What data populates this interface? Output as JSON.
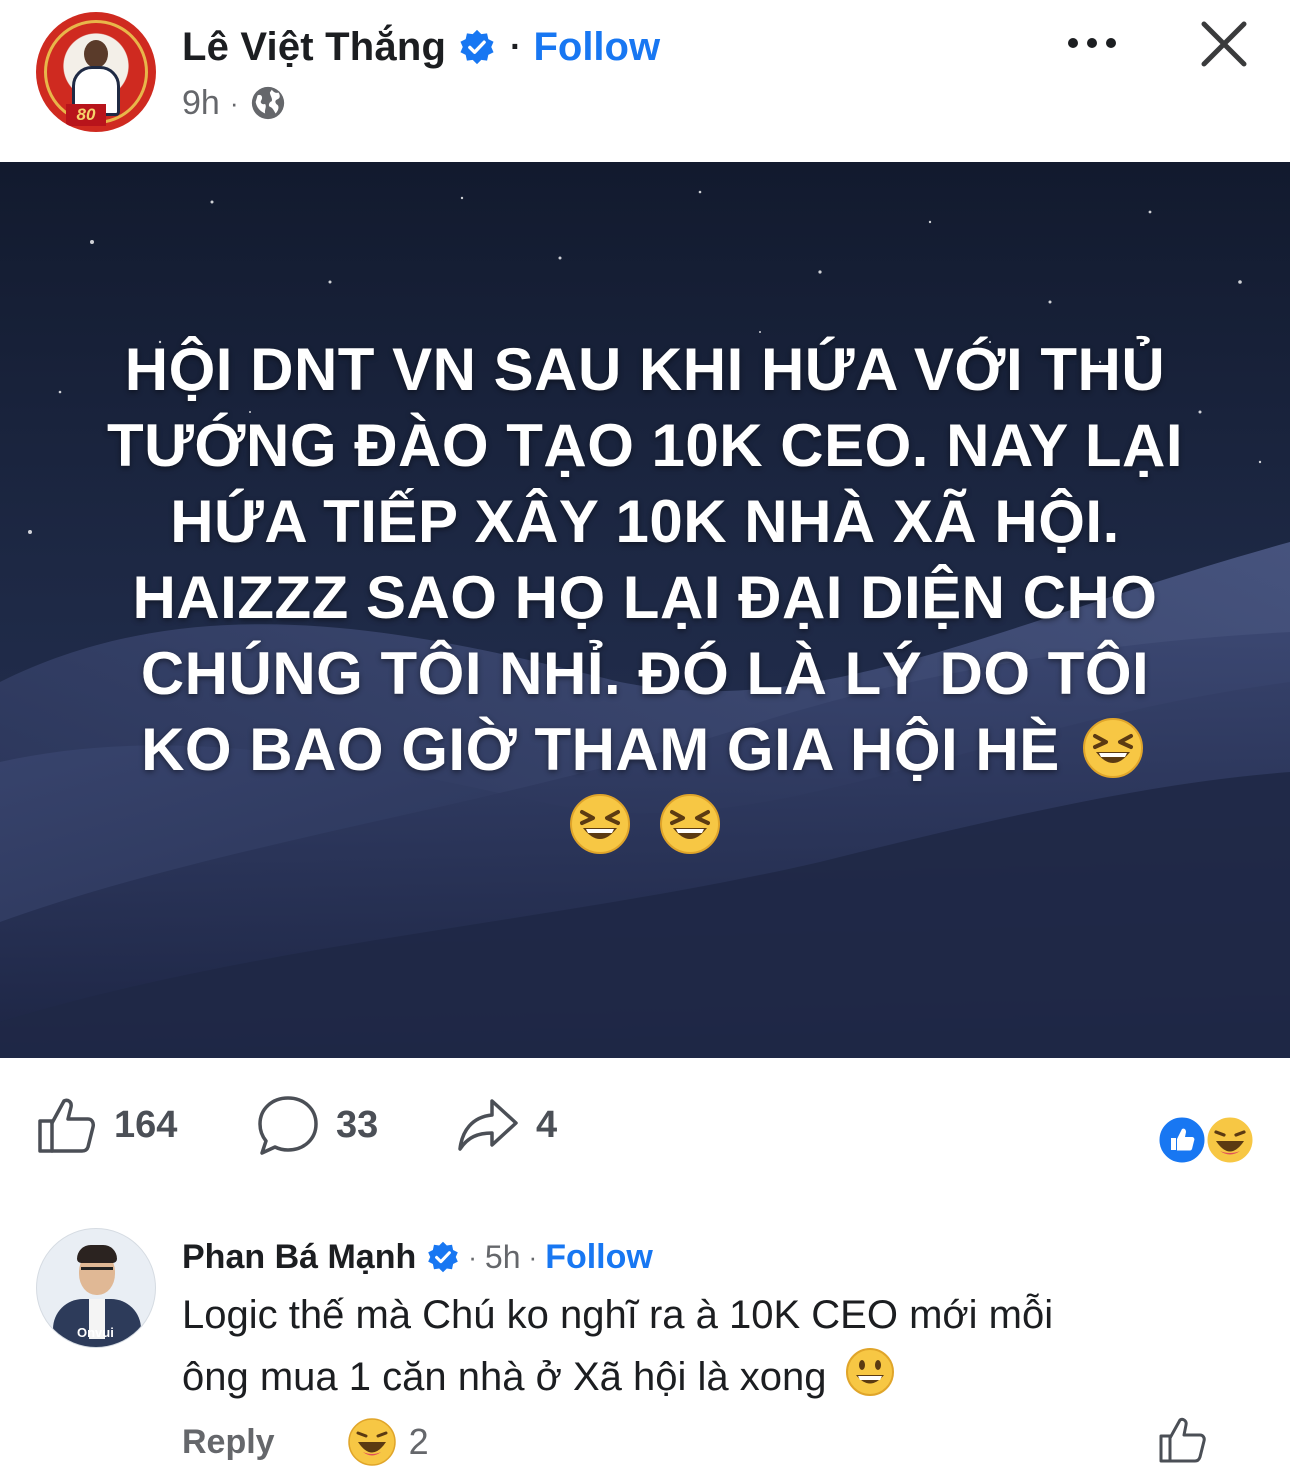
{
  "post": {
    "author": {
      "name": "Lê Việt Thắng",
      "verified": true,
      "avatar_badge_text": "80"
    },
    "follow_label": "Follow",
    "time": "9h",
    "privacy_icon": "globe-icon",
    "header_icons": [
      "more-icon",
      "close-icon"
    ],
    "image_text_lines": [
      "HỘI DNT VN SAU KHI HỨA VỚI THỦ",
      "TƯỚNG ĐÀO TẠO 10K CEO. NAY LẠI",
      "HỨA TIẾP XÂY 10K NHÀ XÃ HỘI.",
      "HAIZZZ SAO HỌ LẠI ĐẠI DIỆN CHO",
      "CHÚNG TÔI NHỈ. ĐÓ LÀ LÝ DO TÔI",
      "KO BAO GIỜ THAM GIA HỘI HÈ"
    ],
    "image_emojis": [
      "laughing-emoji",
      "laughing-emoji",
      "laughing-emoji"
    ],
    "stats": {
      "likes": "164",
      "comments": "33",
      "shares": "4"
    },
    "reaction_icons": [
      "like-reaction-icon",
      "haha-reaction-icon"
    ]
  },
  "comment": {
    "author": {
      "name": "Phan Bá Mạnh",
      "verified": true,
      "avatar_logo_text": "Onvui"
    },
    "time": "5h",
    "follow_label": "Follow",
    "text_lines": [
      "Logic thế mà Chú ko nghĩ ra à 10K CEO mới mỗi",
      "ông mua 1 căn nhà ở Xã hội là xong"
    ],
    "text_emoji": "grinning-emoji",
    "reply_label": "Reply",
    "reaction_count": "2",
    "reaction_icon": "haha-reaction-icon"
  },
  "colors": {
    "accent": "#1877f2",
    "text": "#1c1e21",
    "muted": "#65676b",
    "night_sky": "#1b2540"
  }
}
